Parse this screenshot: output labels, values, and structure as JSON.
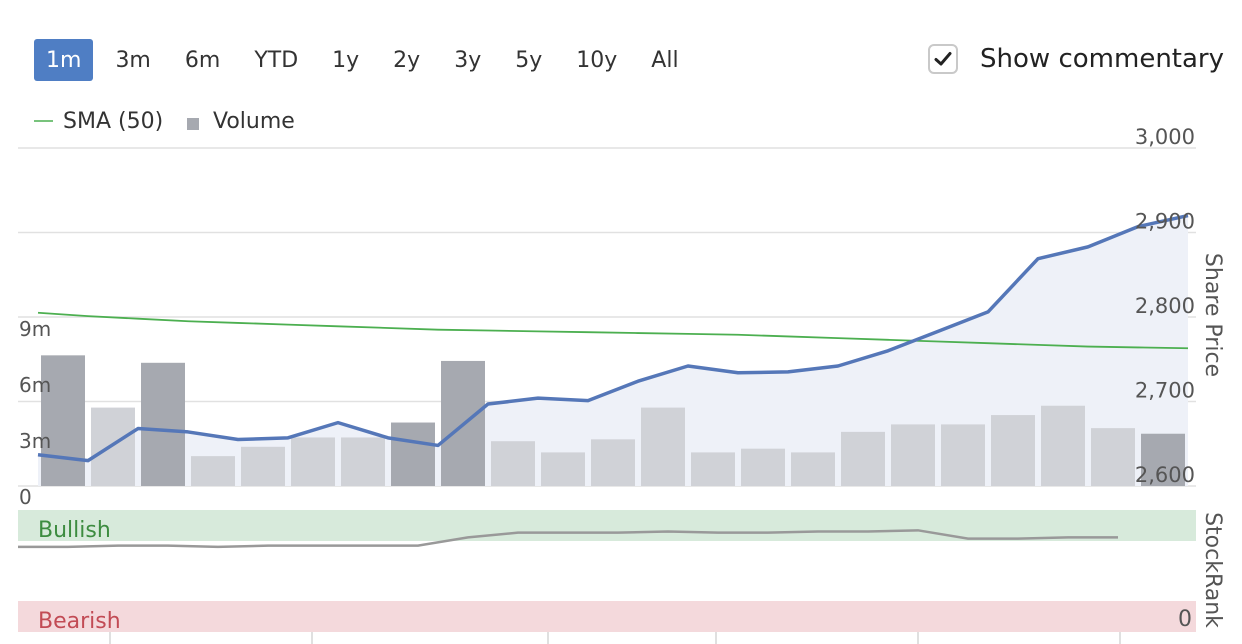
{
  "ranges": [
    "1m",
    "3m",
    "6m",
    "YTD",
    "1y",
    "2y",
    "3y",
    "5y",
    "10y",
    "All"
  ],
  "active_range": "1m",
  "commentary": {
    "label": "Show commentary",
    "checked": true
  },
  "legend": {
    "sma": "SMA (50)",
    "volume": "Volume"
  },
  "colors": {
    "price": "#5577b8",
    "price_fill": "#eef1f8",
    "sma": "#4caf50",
    "volume_bar": "#d0d2d7",
    "volume_bar_highlight": "#a6a9b0",
    "bullish_band": "#d7eadb",
    "bearish_band": "#f4d9dc",
    "bullish_text": "#3d8c40",
    "bearish_text": "#c24b55",
    "stockrank_line": "#999999"
  },
  "chart_data": {
    "type": "line",
    "price_axis": {
      "label": "Share Price",
      "ticks": [
        "3,000",
        "2,900",
        "2,800",
        "2,700",
        "2,600"
      ],
      "range": [
        2600,
        3000
      ]
    },
    "volume_axis": {
      "ticks": [
        "9m",
        "6m",
        "3m",
        "0"
      ],
      "range": [
        0,
        9
      ]
    },
    "x": [
      0,
      1,
      2,
      3,
      4,
      5,
      6,
      7,
      8,
      9,
      10,
      11,
      12,
      13,
      14,
      15,
      16,
      17,
      18,
      19,
      20,
      21,
      22,
      23
    ],
    "series": [
      {
        "name": "Share Price",
        "values": [
          2637,
          2630,
          2668,
          2664,
          2655,
          2657,
          2675,
          2657,
          2648,
          2697,
          2704,
          2701,
          2724,
          2742,
          2734,
          2735,
          2742,
          2760,
          2783,
          2806,
          2869,
          2883,
          2907,
          2920
        ]
      },
      {
        "name": "SMA (50)",
        "values": [
          2805,
          2801,
          2798,
          2795,
          2793,
          2791,
          2789,
          2787,
          2785,
          2784,
          2783,
          2782,
          2781,
          2780,
          2779,
          2777,
          2775,
          2773,
          2771,
          2769,
          2767,
          2765,
          2764,
          2763
        ]
      },
      {
        "name": "Volume",
        "values": [
          7.0,
          4.2,
          6.6,
          1.6,
          2.1,
          2.6,
          2.6,
          3.4,
          6.7,
          2.4,
          1.8,
          2.5,
          4.2,
          1.8,
          2.0,
          1.8,
          2.9,
          3.3,
          3.3,
          3.8,
          4.3,
          3.1,
          2.8
        ],
        "highlight": [
          true,
          false,
          true,
          false,
          false,
          false,
          false,
          true,
          true,
          false,
          false,
          false,
          false,
          false,
          false,
          false,
          false,
          false,
          false,
          false,
          false,
          false,
          true
        ]
      }
    ],
    "stockrank": {
      "label": "StockRank",
      "bullish_label": "Bullish",
      "bearish_label": "Bearish",
      "zero_label": "0",
      "values": [
        62,
        62,
        63,
        63,
        62,
        63,
        63,
        63,
        63,
        70,
        74,
        74,
        74,
        75,
        74,
        74,
        75,
        75,
        76,
        69,
        69,
        70,
        70
      ]
    }
  }
}
